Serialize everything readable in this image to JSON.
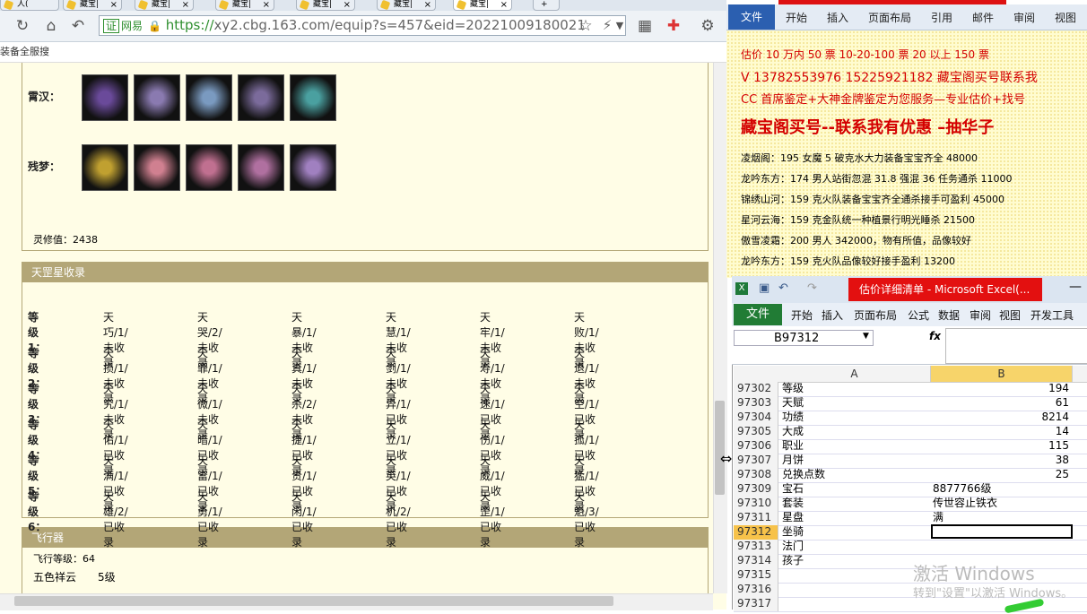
{
  "browser": {
    "tabs": [
      "人(",
      "藏宝|",
      "藏宝|",
      "藏宝|",
      "藏宝|",
      "藏宝|",
      "藏宝|"
    ],
    "url": {
      "cert_label": "证",
      "site_label": "网易",
      "scheme": "https://",
      "rest": "xy2.cbg.163.com/equip?s=457&eid=20221009180021",
      "lightning": "⚡"
    },
    "bookmark_text": "装备全服搜"
  },
  "page": {
    "equip_rows": [
      {
        "label": "霄汉：",
        "icon_colors": [
          "#6a4a9a",
          "#8a7ab0",
          "#7a9ac0",
          "#7b6b9b",
          "#4aa0a0"
        ]
      },
      {
        "label": "残梦：",
        "icon_colors": [
          "#c0a030",
          "#d08090",
          "#c07090",
          "#b070a0",
          "#a080c0"
        ]
      }
    ],
    "lingxiu": "灵修值：2438",
    "stars_panel": {
      "title": "天罡星收录",
      "rows": [
        {
          "label": "等级1：",
          "items": [
            "天巧/1/未收录",
            "天哭/2/未收录",
            "天暴/1/未收录",
            "天慧/1/未收录",
            "天牢/1/未收录",
            "天败/1/未收录"
          ]
        },
        {
          "label": "等级2：",
          "items": [
            "天损/1/未收录",
            "天罪/1/未收录",
            "天真/1/未收录",
            "天剑/1/未收录",
            "天寿/1/未收录",
            "天退/1/未收录"
          ]
        },
        {
          "label": "等级3：",
          "items": [
            "天究/1/未收录",
            "天微/1/未收录",
            "天杀/2/未收录",
            "天异/1/已收录",
            "天速/1/已收录",
            "天空/1/已收录"
          ]
        },
        {
          "label": "等级4：",
          "items": [
            "天佑/1/已收录",
            "天暗/1/已收录",
            "天捷/1/已收录",
            "天立/1/已收录",
            "天伤/1/已收录",
            "天孤/1/已收录"
          ]
        },
        {
          "label": "等级5：",
          "items": [
            "天满/1/已收录",
            "天富/1/已收录",
            "天贵/1/已收录",
            "天英/1/已收录",
            "天威/1/已收录",
            "天猛/1/已收录"
          ]
        },
        {
          "label": "等级6：",
          "items": [
            "天雄/2/已收录",
            "天勇/1/已收录",
            "天闲/1/已收录",
            "天机/2/已收录",
            "天罡/1/已收录",
            "天魁/3/已收录"
          ]
        }
      ]
    },
    "flyer_panel": {
      "title": "飞行器",
      "level": "飞行等级：64",
      "cloud_name": "五色祥云",
      "cloud_level": "5级"
    }
  },
  "word": {
    "file_tab": "文件",
    "tabs": [
      "开始",
      "插入",
      "页面布局",
      "引用",
      "邮件",
      "审阅",
      "视图"
    ],
    "lines": [
      {
        "text": "估价 10 万内 50 票    10-20-100 票      20 以上 150 票",
        "cls": "red",
        "size": 12
      },
      {
        "text": "V 13782553976   15225921182  藏宝阁买号联系我",
        "cls": "red",
        "size": 14
      },
      {
        "text": "CC 首席鉴定+大神金牌鉴定为您服务—专业估价+找号",
        "cls": "red",
        "size": 13
      },
      {
        "text": "藏宝阁买号--联系我有优惠 –抽华子",
        "cls": "red",
        "size": 18
      },
      {
        "text": "凌烟阁：195 女魔 5 破克水大力装备宝宝齐全 48000",
        "cls": "",
        "size": 11
      },
      {
        "text": "龙吟东方：174 男人站街忽混 31.8 强混 36 任务通杀 11000",
        "cls": "",
        "size": 11
      },
      {
        "text": "锦绣山河：159 克火队装备宝宝齐全通杀接手可盈利 45000",
        "cls": "",
        "size": 11
      },
      {
        "text": "星河云海：159 克金队统一种植景行明光睡杀 21500",
        "cls": "",
        "size": 11
      },
      {
        "text": "傲雪凌霜：200 男人 342000，物有所值，品像较好",
        "cls": "",
        "size": 11
      },
      {
        "text": "龙吟东方：159 克火队品像较好接手盈利 13200",
        "cls": "",
        "size": 11
      }
    ]
  },
  "excel": {
    "title": "估价详细清单 - Microsoft Excel(...",
    "file_tab": "文件",
    "ribbon_tabs": [
      "开始",
      "插入",
      "页面布局",
      "公式",
      "数据",
      "审阅",
      "视图",
      "开发工具"
    ],
    "name_box": "B97312",
    "fx": "fx",
    "col_a": "A",
    "col_b": "B",
    "rows": [
      {
        "n": "97302",
        "a": "等级",
        "b": "194",
        "num": true
      },
      {
        "n": "97303",
        "a": "天赋",
        "b": "61",
        "num": true
      },
      {
        "n": "97304",
        "a": "功绩",
        "b": "8214",
        "num": true
      },
      {
        "n": "97305",
        "a": "大成",
        "b": "14",
        "num": true
      },
      {
        "n": "97306",
        "a": "职业",
        "b": "115",
        "num": true
      },
      {
        "n": "97307",
        "a": "月饼",
        "b": "38",
        "num": true
      },
      {
        "n": "97308",
        "a": "兑换点数",
        "b": "25",
        "num": true
      },
      {
        "n": "97309",
        "a": "宝石",
        "b": "8877766级",
        "num": false
      },
      {
        "n": "97310",
        "a": "套装",
        "b": "传世容止铁衣",
        "num": false
      },
      {
        "n": "97311",
        "a": "星盘",
        "b": "满",
        "num": false
      },
      {
        "n": "97312",
        "a": "坐骑",
        "b": "",
        "num": false
      },
      {
        "n": "97313",
        "a": "法门",
        "b": "",
        "num": false
      },
      {
        "n": "97314",
        "a": "孩子",
        "b": "",
        "num": false
      },
      {
        "n": "97315",
        "a": "",
        "b": "",
        "num": false
      },
      {
        "n": "97316",
        "a": "",
        "b": "",
        "num": false
      },
      {
        "n": "97317",
        "a": "",
        "b": "",
        "num": false
      }
    ],
    "selected_row": "97312"
  },
  "watermark": {
    "line1": "激活 Windows",
    "line2": "转到\"设置\"以激活 Windows。"
  }
}
